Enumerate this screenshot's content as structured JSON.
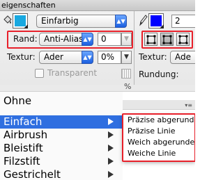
{
  "window": {
    "title": "eigenschaften"
  },
  "fill": {
    "swatch_color": "#18a8e0",
    "type_value": "Einfarbig"
  },
  "stroke": {
    "swatch_color": "#0000ff",
    "width_value": "2"
  },
  "rendering": {
    "label": "Rand:",
    "value": "Anti-Alias",
    "amount_value": "0"
  },
  "texture": {
    "label": "Textur:",
    "value": "Ader",
    "percent_value": "0%",
    "right_label": "Textur:",
    "right_value": "Ade"
  },
  "transparent": {
    "label": "Transparent",
    "checked": false
  },
  "rounding": {
    "label": "Rundung:"
  },
  "strip": {
    "percent_text": "%"
  },
  "menu": {
    "items": [
      {
        "label": "Ohne",
        "has_submenu": false,
        "highlighted": false
      },
      {
        "label": "Einfach",
        "has_submenu": true,
        "highlighted": true
      },
      {
        "label": "Airbrush",
        "has_submenu": true,
        "highlighted": false
      },
      {
        "label": "Bleistift",
        "has_submenu": true,
        "highlighted": false
      },
      {
        "label": "Filzstift",
        "has_submenu": true,
        "highlighted": false
      },
      {
        "label": "Gestrichelt",
        "has_submenu": true,
        "highlighted": false
      }
    ]
  },
  "submenu": {
    "items": [
      {
        "label": "Präzise abgerundet"
      },
      {
        "label": "Präzise Linie"
      },
      {
        "label": "Weich abgerundet"
      },
      {
        "label": "Weiche Linie"
      }
    ]
  },
  "colors": {
    "highlight": "#2f6fe0",
    "annotation_red": "#e8202a"
  }
}
